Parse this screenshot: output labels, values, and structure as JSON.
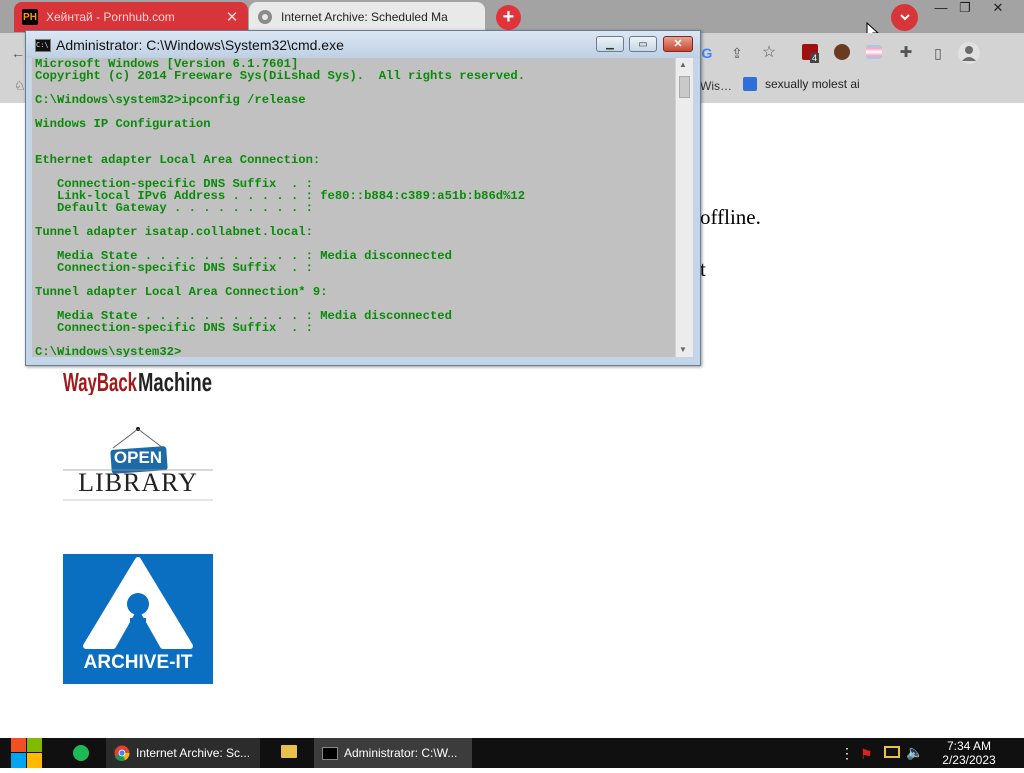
{
  "browser": {
    "tabs": [
      {
        "label": "Хейнтай - Pornhub.com",
        "favicon": "PH",
        "active": false
      },
      {
        "label": "Internet Archive: Scheduled Ma",
        "active": true
      }
    ],
    "new_tab": "+",
    "tab_close": "✕",
    "window_controls": {
      "minimize": "—",
      "restore": "❐",
      "close": "✕"
    },
    "extension_badge": "4",
    "bookmarks": {
      "partial": "Wis…",
      "item": "sexually molest ai"
    }
  },
  "page": {
    "line1_partial": "offline.",
    "line2_partial": "t"
  },
  "cmd": {
    "title": "Administrator: C:\\Windows\\System32\\cmd.exe",
    "icon_text": "C:\\",
    "buttons": {
      "minimize": "▁",
      "maximize": "▭",
      "close": "✕"
    },
    "lines": [
      "Microsoft Windows [Version 6.1.7601]",
      "Copyright (c) 2014 Freeware Sys(DiLshad Sys).  All rights reserved.",
      "",
      "C:\\Windows\\system32>ipconfig /release",
      "",
      "Windows IP Configuration",
      "",
      "",
      "Ethernet adapter Local Area Connection:",
      "",
      "   Connection-specific DNS Suffix  . :",
      "   Link-local IPv6 Address . . . . . : fe80::b884:c389:a51b:b86d%12",
      "   Default Gateway . . . . . . . . . :",
      "",
      "Tunnel adapter isatap.collabnet.local:",
      "",
      "   Media State . . . . . . . . . . . : Media disconnected",
      "   Connection-specific DNS Suffix  . :",
      "",
      "Tunnel adapter Local Area Connection* 9:",
      "",
      "   Media State . . . . . . . . . . . : Media disconnected",
      "   Connection-specific DNS Suffix  . :",
      "",
      "C:\\Windows\\system32>"
    ]
  },
  "logos": {
    "wayback": "WayBackMachine",
    "openlibrary_sign": "OPEN",
    "openlibrary_word": "LIBRARY",
    "archiveit": "ARCHIVE-IT"
  },
  "taskbar": {
    "items": [
      {
        "label": "Internet Archive: Sc..."
      },
      {
        "label": "Administrator: C:\\W..."
      }
    ],
    "time": "7:34 AM",
    "date": "2/23/2023"
  },
  "colors": {
    "console_text": "#0a8a0a",
    "console_bg": "#c1c1c1",
    "archiveit_blue": "#0b6fc1",
    "tab_red": "#d8353a"
  }
}
